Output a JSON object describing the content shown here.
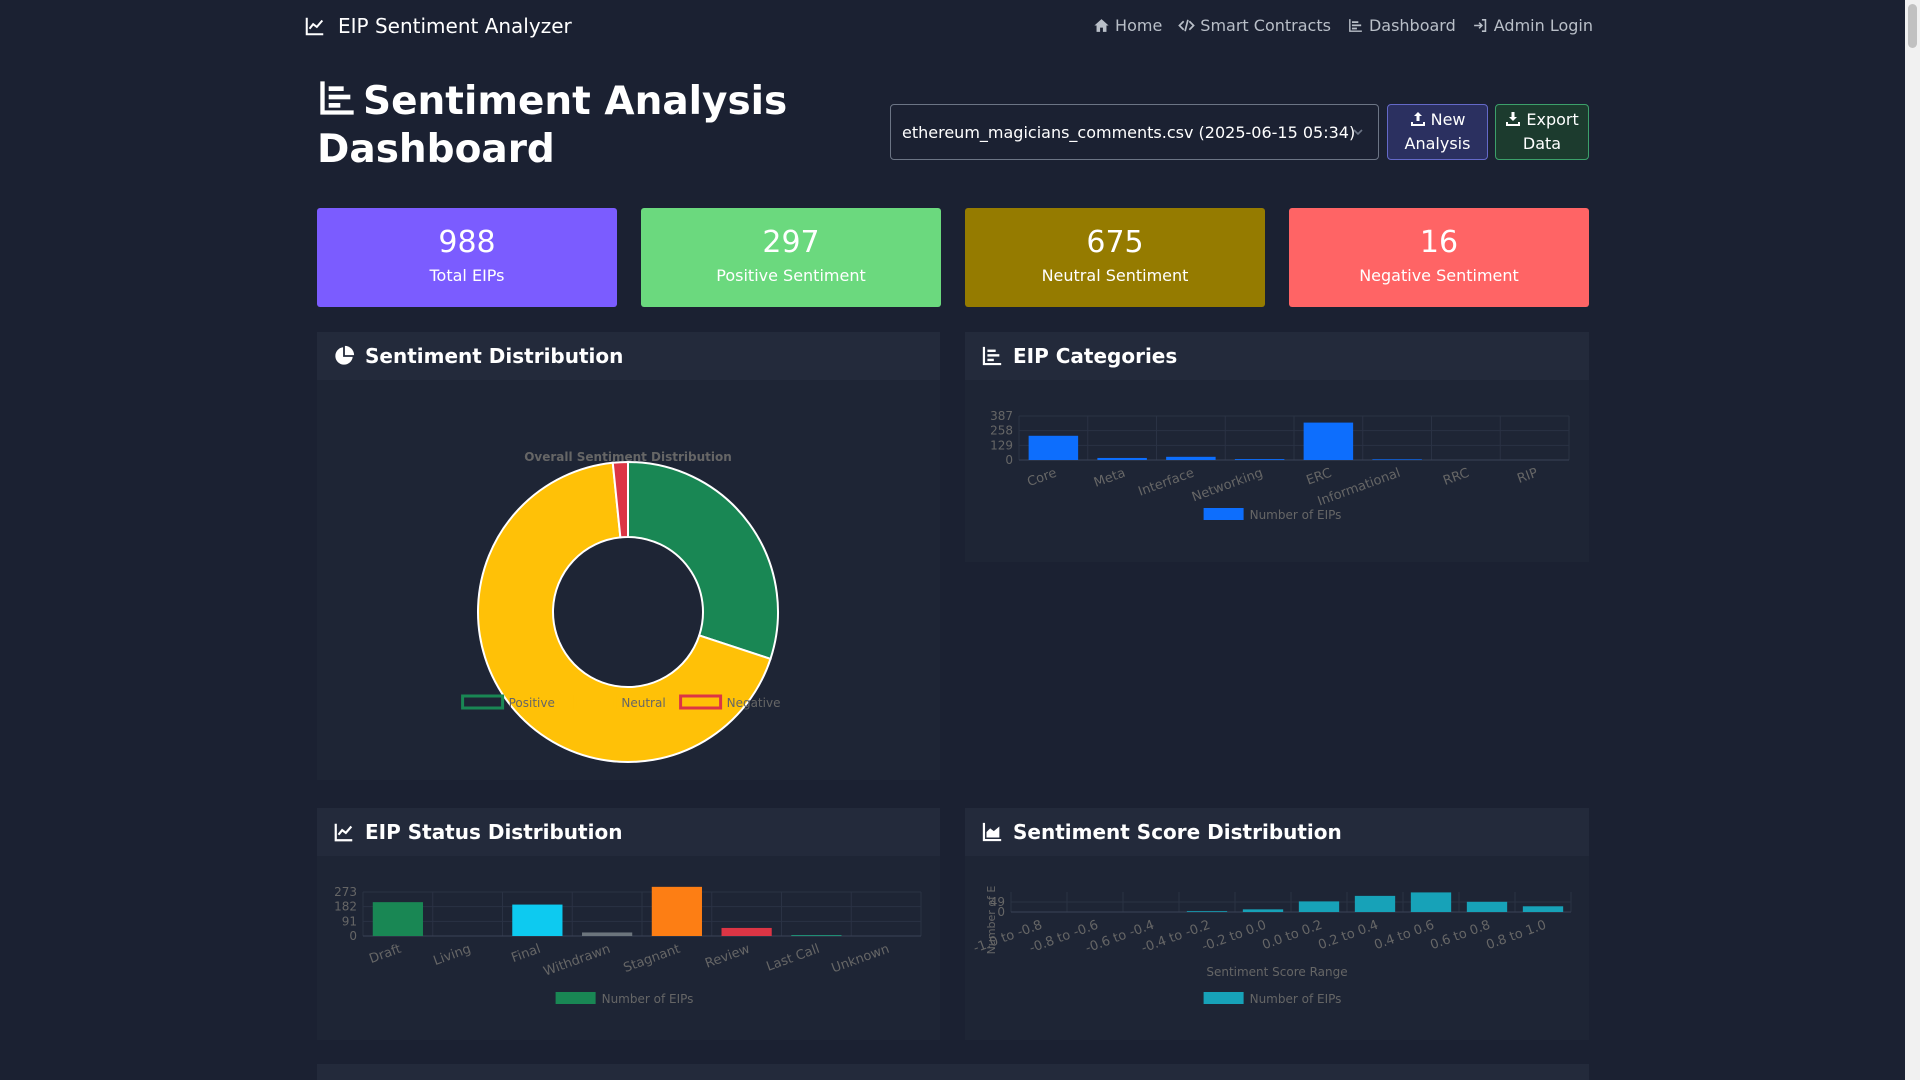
{
  "navbar": {
    "brand": "EIP Sentiment Analyzer",
    "links": [
      {
        "label": "Home",
        "icon": "home-icon"
      },
      {
        "label": "Smart Contracts",
        "icon": "code-icon"
      },
      {
        "label": "Dashboard",
        "icon": "chart-bar-icon"
      },
      {
        "label": "Admin Login",
        "icon": "login-icon"
      }
    ]
  },
  "header": {
    "title": "Sentiment Analysis Dashboard",
    "file_select": "ethereum_magicians_comments.csv (2025-06-15 05:34)",
    "new_label": "New Analysis",
    "export_label": "Export Data"
  },
  "stats": [
    {
      "value": "988",
      "label": "Total EIPs",
      "color": "#7b5cff"
    },
    {
      "value": "297",
      "label": "Positive Sentiment",
      "color": "#6bd97e"
    },
    {
      "value": "675",
      "label": "Neutral Sentiment",
      "color": "#957b00"
    },
    {
      "value": "16",
      "label": "Negative Sentiment",
      "color": "#ff6465"
    }
  ],
  "panels": {
    "sentiment": "Sentiment Distribution",
    "categories": "EIP Categories",
    "status": "EIP Status Distribution",
    "score": "Sentiment Score Distribution"
  },
  "chart_data": [
    {
      "type": "pie",
      "title": "Overall Sentiment Distribution",
      "categories": [
        "Positive",
        "Neutral",
        "Negative"
      ],
      "values": [
        297,
        675,
        16
      ],
      "colors": [
        "#198754",
        "#ffc107",
        "#dc3545"
      ],
      "legend": "bottom"
    },
    {
      "type": "bar",
      "categories": [
        "Core",
        "Meta",
        "Interface",
        "Networking",
        "ERC",
        "Informational",
        "RRC",
        "RIP"
      ],
      "series": [
        {
          "name": "Number of EIPs",
          "values": [
            213,
            18,
            28,
            8,
            329,
            6,
            0,
            0
          ]
        }
      ],
      "yticks": [
        0,
        129,
        258,
        387
      ],
      "ylim": [
        0,
        387
      ],
      "colors": [
        "#0d6efd"
      ],
      "legend": "bottom"
    },
    {
      "type": "bar",
      "categories": [
        "Draft",
        "Living",
        "Final",
        "Withdrawn",
        "Stagnant",
        "Review",
        "Last Call",
        "Unknown"
      ],
      "series": [
        {
          "name": "Number of EIPs",
          "values": [
            210,
            0,
            195,
            22,
            305,
            50,
            4,
            0
          ]
        }
      ],
      "yticks": [
        0,
        91,
        182,
        273
      ],
      "ylim": [
        0,
        273
      ],
      "colors": [
        "#198754",
        "#6f42c1",
        "#0dcaf0",
        "#6c757d",
        "#fd7e14",
        "#dc3545",
        "#20c997",
        "#adb5bd"
      ],
      "legend": "bottom"
    },
    {
      "type": "bar",
      "categories": [
        "-1.0 to -0.8",
        "-0.8 to -0.6",
        "-0.6 to -0.4",
        "-0.4 to -0.2",
        "-0.2 to 0.0",
        "0.0 to 0.2",
        "0.2 to 0.4",
        "0.4 to 0.6",
        "0.6 to 0.8",
        "0.8 to 1.0"
      ],
      "series": [
        {
          "name": "Number of EIPs",
          "values": [
            0,
            0,
            0,
            4,
            13,
            52,
            79,
            96,
            50,
            28
          ]
        }
      ],
      "yticks": [
        0,
        49
      ],
      "ylim": [
        0,
        98
      ],
      "xlabel": "Sentiment Score Range",
      "ylabel": "Number of E",
      "colors": [
        "#17a2b8"
      ],
      "legend": "bottom"
    }
  ]
}
